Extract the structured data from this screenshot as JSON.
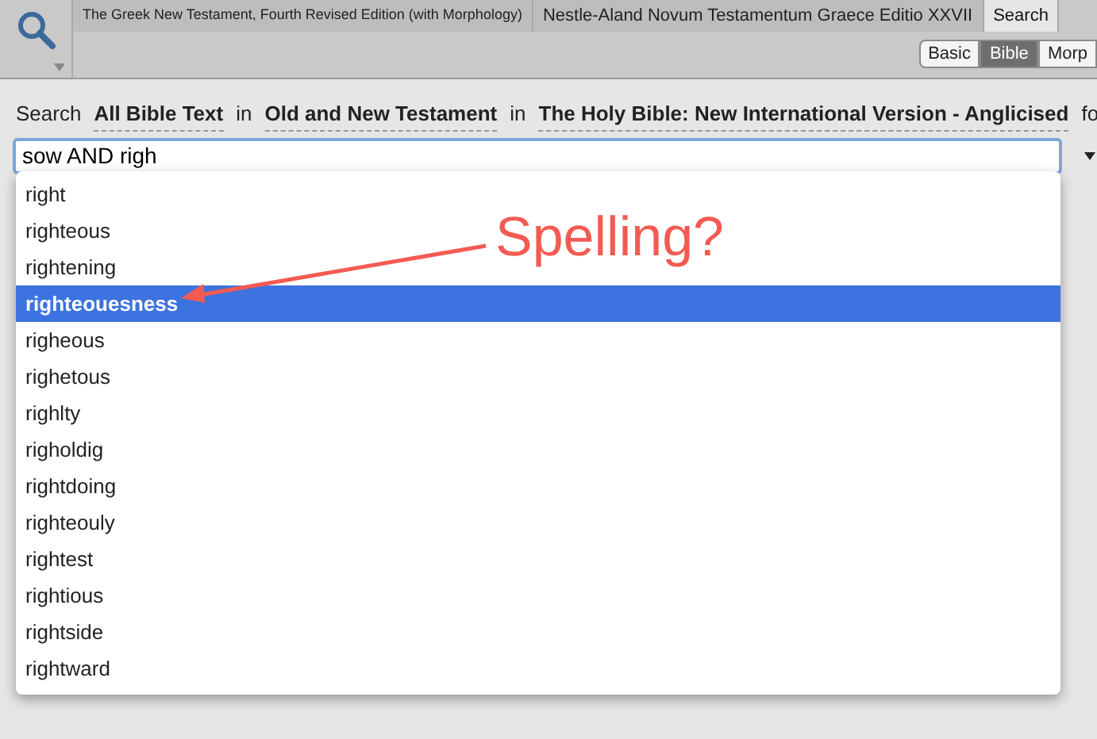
{
  "tabs": [
    {
      "label": "The Greek New Testament, Fourth Revised Edition (with Morphology)",
      "selected": false
    },
    {
      "label": "Nestle-Aland Novum Testamentum Graece Editio XXVII",
      "selected": false
    },
    {
      "label": "Search",
      "selected": true
    }
  ],
  "modes": [
    {
      "label": "Basic",
      "selected": false
    },
    {
      "label": "Bible",
      "selected": true
    },
    {
      "label": "Morp",
      "selected": false
    }
  ],
  "search_line": [
    {
      "kind": "text",
      "text": "Search"
    },
    {
      "kind": "choice",
      "text": "All Bible Text"
    },
    {
      "kind": "text",
      "text": "in"
    },
    {
      "kind": "choice",
      "text": "Old and New Testament"
    },
    {
      "kind": "text",
      "text": "in"
    },
    {
      "kind": "choice",
      "text": "The Holy Bible: New International Version - Anglicised"
    },
    {
      "kind": "text",
      "text": "fo"
    }
  ],
  "search_field": {
    "value": "sow AND righ"
  },
  "suggestions": [
    {
      "text": "right",
      "selected": false
    },
    {
      "text": "righteous",
      "selected": false
    },
    {
      "text": "rightening",
      "selected": false
    },
    {
      "text": "righteouesness",
      "selected": true
    },
    {
      "text": "righeous",
      "selected": false
    },
    {
      "text": "righetous",
      "selected": false
    },
    {
      "text": "righlty",
      "selected": false
    },
    {
      "text": "righoldig",
      "selected": false
    },
    {
      "text": "rightdoing",
      "selected": false
    },
    {
      "text": "righteouly",
      "selected": false
    },
    {
      "text": "rightest",
      "selected": false
    },
    {
      "text": "rightious",
      "selected": false
    },
    {
      "text": "rightside",
      "selected": false
    },
    {
      "text": "rightward",
      "selected": false
    }
  ],
  "annotation": {
    "text": "Spelling?"
  }
}
